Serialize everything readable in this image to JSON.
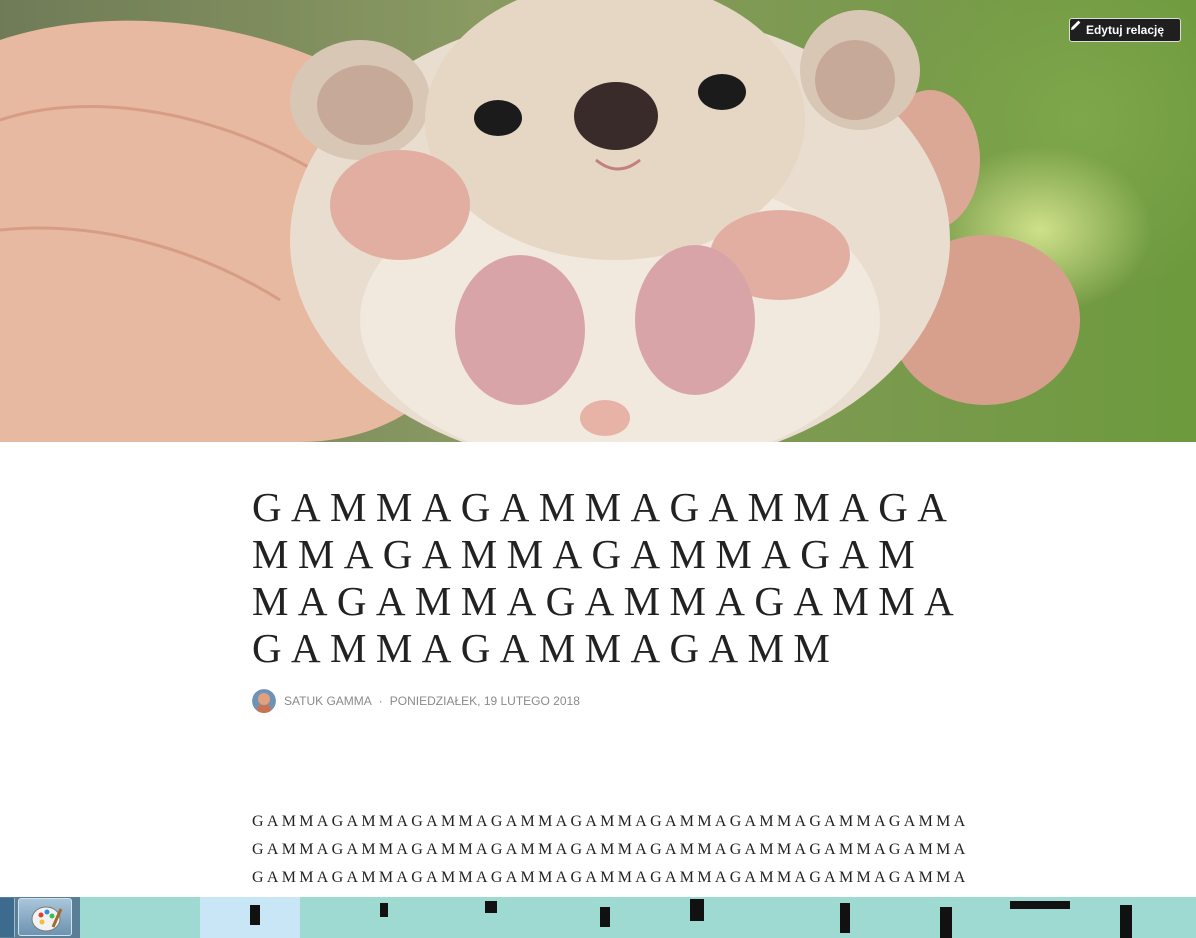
{
  "hero": {
    "edit_button_label": "Edytuj relację"
  },
  "post": {
    "title": "GAMMAGAMMAGAMMAGAMMAGAMMAGAMMAGAMMAGAMMAGAMMAGAMMAGAMMAGAMMAGAMM",
    "author": "SATUK GAMMA",
    "separator": "·",
    "date": "PONIEDZIAŁEK, 19 LUTEGO 2018",
    "body_lines": [
      "GAMMAGAMMAGAMMAGAMMAGAMMAGAMMAGAMMAGAMMAGAMMA",
      "GAMMAGAMMAGAMMAGAMMAGAMMAGAMMAGAMMAGAMMAGAMMA",
      "GAMMAGAMMAGAMMAGAMMAGAMMAGAMMAGAMMAGAMMAGAMMA"
    ]
  },
  "taskbar": {
    "pinned_app_icon": "paint-icon"
  }
}
